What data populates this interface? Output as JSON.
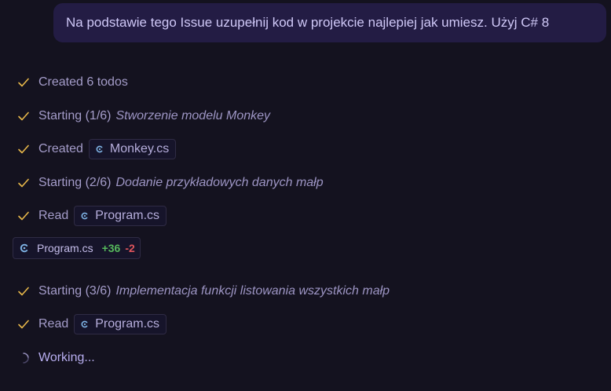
{
  "user_message": "Na podstawie tego Issue uzupełnij kod w projekcie najlepiej jak umiesz. Użyj C# 8",
  "steps": [
    {
      "text": "Created 6 todos"
    },
    {
      "text": "Starting (1/6)",
      "title": "Stworzenie modelu Monkey"
    },
    {
      "text": "Created",
      "file": "Monkey.cs"
    },
    {
      "text": "Starting (2/6)",
      "title": "Dodanie przykładowych danych małp"
    },
    {
      "text": "Read",
      "file": "Program.cs"
    },
    {
      "text": "Starting (3/6)",
      "title": "Implementacja funkcji listowania wszystkich małp"
    },
    {
      "text": "Read",
      "file": "Program.cs"
    }
  ],
  "diff": {
    "file": "Program.cs",
    "added": "+36",
    "removed": "-2"
  },
  "status": "Working...",
  "colors": {
    "check": "#e8b84a",
    "added": "#56b85c",
    "removed": "#e0555c",
    "accent": "#b8aef0"
  },
  "icons": {
    "step": "check-icon",
    "file": "csharp-file-icon",
    "progress": "spinner-icon"
  }
}
